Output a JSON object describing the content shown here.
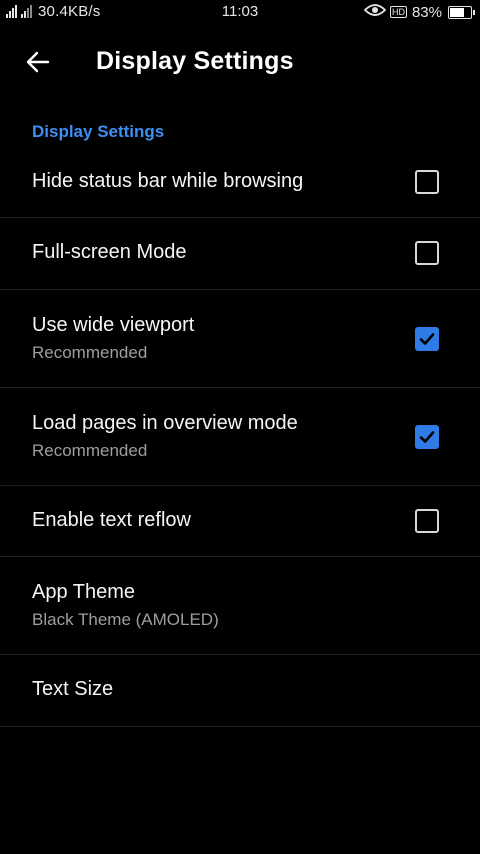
{
  "status_bar": {
    "network_speed": "30.4KB/s",
    "time": "11:03",
    "hd_badge": "HD",
    "battery_text": "83%",
    "battery_level_percent": 83,
    "icons": [
      "signal-icon",
      "signal-icon",
      "eye-icon",
      "hd-icon",
      "battery-icon"
    ]
  },
  "toolbar": {
    "back_icon": "arrow-left-icon",
    "title": "Display Settings"
  },
  "section": {
    "header": "Display Settings"
  },
  "settings": [
    {
      "title": "Hide status bar while browsing",
      "summary": "",
      "checkbox": true,
      "checked": false
    },
    {
      "title": "Full-screen Mode",
      "summary": "",
      "checkbox": true,
      "checked": false
    },
    {
      "title": "Use wide viewport",
      "summary": "Recommended",
      "checkbox": true,
      "checked": true
    },
    {
      "title": "Load pages in overview mode",
      "summary": "Recommended",
      "checkbox": true,
      "checked": true
    },
    {
      "title": "Enable text reflow",
      "summary": "",
      "checkbox": true,
      "checked": false
    },
    {
      "title": "App Theme",
      "summary": "Black Theme (AMOLED)",
      "checkbox": false,
      "checked": false
    },
    {
      "title": "Text Size",
      "summary": "",
      "checkbox": false,
      "checked": false
    }
  ],
  "colors": {
    "background": "#000000",
    "accent": "#3f8ef2",
    "checkbox_checked": "#2f7ce8",
    "divider": "#1f1f1f",
    "summary_text": "#9e9e9e"
  }
}
